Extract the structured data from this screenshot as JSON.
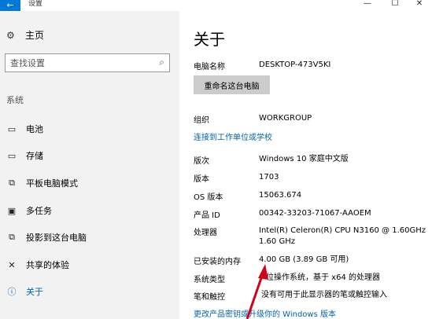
{
  "window": {
    "title": "设置",
    "back_glyph": "←",
    "minimize_glyph": "—",
    "maximize_glyph": "☐",
    "close_glyph": "✕"
  },
  "sidebar": {
    "home_label": "主页",
    "search_placeholder": "查找设置",
    "section_header": "系统",
    "items": [
      {
        "label": "电池",
        "icon": "battery-icon",
        "active": false
      },
      {
        "label": "存储",
        "icon": "storage-icon",
        "active": false
      },
      {
        "label": "平板电脑模式",
        "icon": "tablet-mode-icon",
        "active": false
      },
      {
        "label": "多任务",
        "icon": "multitasking-icon",
        "active": false
      },
      {
        "label": "投影到这台电脑",
        "icon": "projecting-icon",
        "active": false
      },
      {
        "label": "共享的体验",
        "icon": "shared-experiences-icon",
        "active": false
      },
      {
        "label": "关于",
        "icon": "about-icon",
        "active": true
      }
    ]
  },
  "main": {
    "title": "关于",
    "pc_name_label": "电脑名称",
    "pc_name_value": "DESKTOP-473V5KI",
    "rename_button": "重命名这台电脑",
    "org_label": "组织",
    "org_value": "WORKGROUP",
    "join_link": "连接到工作单位或学校",
    "edition_label": "版次",
    "edition_value": "Windows 10 家庭中文版",
    "version_label": "版本",
    "version_value": "1703",
    "build_label": "OS 版本",
    "build_value": "15063.674",
    "product_id_label": "产品 ID",
    "product_id_value": "00342-33203-71067-AAOEM",
    "processor_label": "处理器",
    "processor_value_line1": "Intel(R) Celeron(R) CPU  N3160  @ 1.60GHz",
    "processor_value_line2": "1.60 GHz",
    "ram_label": "已安装的内存",
    "ram_value": "4.00 GB (3.89 GB 可用)",
    "system_type_label": "系统类型",
    "system_type_value": "位操作系统，基于 x64 的处理器",
    "pen_touch_label": "笔和触控",
    "pen_touch_value": "没有可用于此显示器的笔或触控输入",
    "change_key_link": "更改产品密钥或升级你的 Windows 版本"
  },
  "colors": {
    "accent": "#0078d7",
    "link": "#0063b1",
    "sidebar_bg": "#f2f2f2",
    "button_bg": "#cccccc",
    "annotation_arrow": "#d0021b"
  }
}
